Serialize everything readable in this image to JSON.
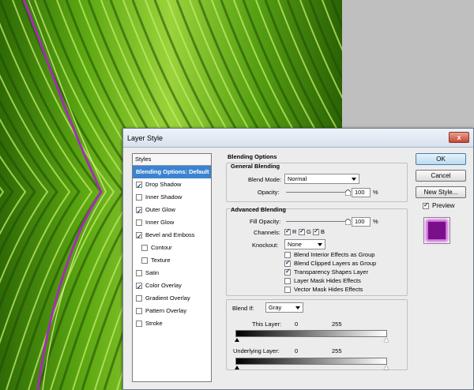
{
  "dialog": {
    "title": "Layer Style",
    "close_label": "x"
  },
  "styles_panel": {
    "header": "Styles",
    "items": [
      {
        "label": "Blending Options: Default",
        "checkbox": false,
        "checked": false,
        "selected": true,
        "indent": false
      },
      {
        "label": "Drop Shadow",
        "checkbox": true,
        "checked": true,
        "selected": false,
        "indent": false
      },
      {
        "label": "Inner Shadow",
        "checkbox": true,
        "checked": false,
        "selected": false,
        "indent": false
      },
      {
        "label": "Outer Glow",
        "checkbox": true,
        "checked": true,
        "selected": false,
        "indent": false
      },
      {
        "label": "Inner Glow",
        "checkbox": true,
        "checked": false,
        "selected": false,
        "indent": false
      },
      {
        "label": "Bevel and Emboss",
        "checkbox": true,
        "checked": true,
        "selected": false,
        "indent": false
      },
      {
        "label": "Contour",
        "checkbox": true,
        "checked": false,
        "selected": false,
        "indent": true
      },
      {
        "label": "Texture",
        "checkbox": true,
        "checked": false,
        "selected": false,
        "indent": true
      },
      {
        "label": "Satin",
        "checkbox": true,
        "checked": false,
        "selected": false,
        "indent": false
      },
      {
        "label": "Color Overlay",
        "checkbox": true,
        "checked": true,
        "selected": false,
        "indent": false
      },
      {
        "label": "Gradient Overlay",
        "checkbox": true,
        "checked": false,
        "selected": false,
        "indent": false
      },
      {
        "label": "Pattern Overlay",
        "checkbox": true,
        "checked": false,
        "selected": false,
        "indent": false
      },
      {
        "label": "Stroke",
        "checkbox": true,
        "checked": false,
        "selected": false,
        "indent": false
      }
    ]
  },
  "blending": {
    "section_title": "Blending Options",
    "general": {
      "title": "General Blending",
      "blend_mode_label": "Blend Mode:",
      "blend_mode_value": "Normal",
      "opacity_label": "Opacity:",
      "opacity_value": "100",
      "opacity_unit": "%",
      "opacity_level": 1.0
    },
    "advanced": {
      "title": "Advanced Blending",
      "fill_opacity_label": "Fill Opacity:",
      "fill_opacity_value": "100",
      "fill_opacity_unit": "%",
      "fill_opacity_level": 1.0,
      "channels_label": "Channels:",
      "channels": [
        {
          "label": "R",
          "checked": true
        },
        {
          "label": "G",
          "checked": true
        },
        {
          "label": "B",
          "checked": true
        }
      ],
      "knockout_label": "Knockout:",
      "knockout_value": "None",
      "options": [
        {
          "label": "Blend Interior Effects as Group",
          "checked": false
        },
        {
          "label": "Blend Clipped Layers as Group",
          "checked": true
        },
        {
          "label": "Transparency Shapes Layer",
          "checked": true
        },
        {
          "label": "Layer Mask Hides Effects",
          "checked": false
        },
        {
          "label": "Vector Mask Hides Effects",
          "checked": false
        }
      ]
    },
    "blend_if": {
      "label": "Blend If:",
      "value": "Gray",
      "this_layer_label": "This Layer:",
      "this_layer_min": "0",
      "this_layer_max": "255",
      "underlying_label": "Underlying Layer:",
      "underlying_min": "0",
      "underlying_max": "255"
    }
  },
  "buttons": {
    "ok": "OK",
    "cancel": "Cancel",
    "new_style": "New Style...",
    "preview_label": "Preview",
    "preview_checked": true
  },
  "colors": {
    "selection": "#3b83d0",
    "preview_fill": "#7a0f8c",
    "leaf_green": "#3f8a0c"
  }
}
